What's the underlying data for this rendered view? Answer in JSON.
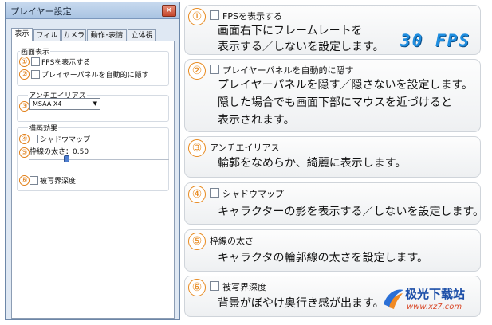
{
  "dialog": {
    "title": "プレイヤー設定",
    "close_glyph": "✕",
    "tabs": [
      "表示",
      "フィルタ",
      "カメラ",
      "動作･表情",
      "立体視"
    ],
    "screen_group": {
      "label": "画面表示",
      "fps_option": "FPSを表示する",
      "panel_option": "プレイヤーパネルを自動的に隠す"
    },
    "antialias_group": {
      "label": "アンチエイリアス",
      "selected": "MSAA X4",
      "arrow_glyph": "▼"
    },
    "effects_group": {
      "label": "描画効果",
      "shadow_option": "シャドウマップ",
      "outline_label": "枠線の太さ：0.50",
      "outline_value": 0.5,
      "dof_option": "被写界深度"
    },
    "markers": [
      "①",
      "②",
      "③",
      "④",
      "⑤",
      "⑥"
    ]
  },
  "cards": [
    {
      "num": "①",
      "title": "FPSを表示する",
      "checkbox": true,
      "lines": [
        "画面右下にフレームレートを",
        "表示する／しないを設定します。"
      ]
    },
    {
      "num": "②",
      "title": "プレイヤーパネルを自動的に隠す",
      "checkbox": true,
      "lines": [
        "プレイヤーパネルを隠す／隠さないを設定します。",
        "隠した場合でも画面下部にマウスを近づけると",
        "表示されます。"
      ]
    },
    {
      "num": "③",
      "title": "アンチエイリアス",
      "checkbox": false,
      "lines": [
        "輪郭をなめらか、綺麗に表示します。"
      ]
    },
    {
      "num": "④",
      "title": "シャドウマップ",
      "checkbox": true,
      "lines": [
        "キャラクターの影を表示する／しないを設定します。"
      ]
    },
    {
      "num": "⑤",
      "title": "枠線の太さ",
      "checkbox": false,
      "lines": [
        "キャラクタの輪郭線の太さを設定します。"
      ]
    },
    {
      "num": "⑥",
      "title": "被写界深度",
      "checkbox": true,
      "lines": [
        "背景がぼやけ奥行き感が出ます。"
      ]
    }
  ],
  "fps_display": "30 FPS",
  "watermark": {
    "name": "极光下载站",
    "url": "www.xz7.com"
  },
  "colors": {
    "accent_orange": "#e88a1f",
    "fps_blue": "#1f8ee0",
    "titlebar": "#a9c3e2"
  }
}
